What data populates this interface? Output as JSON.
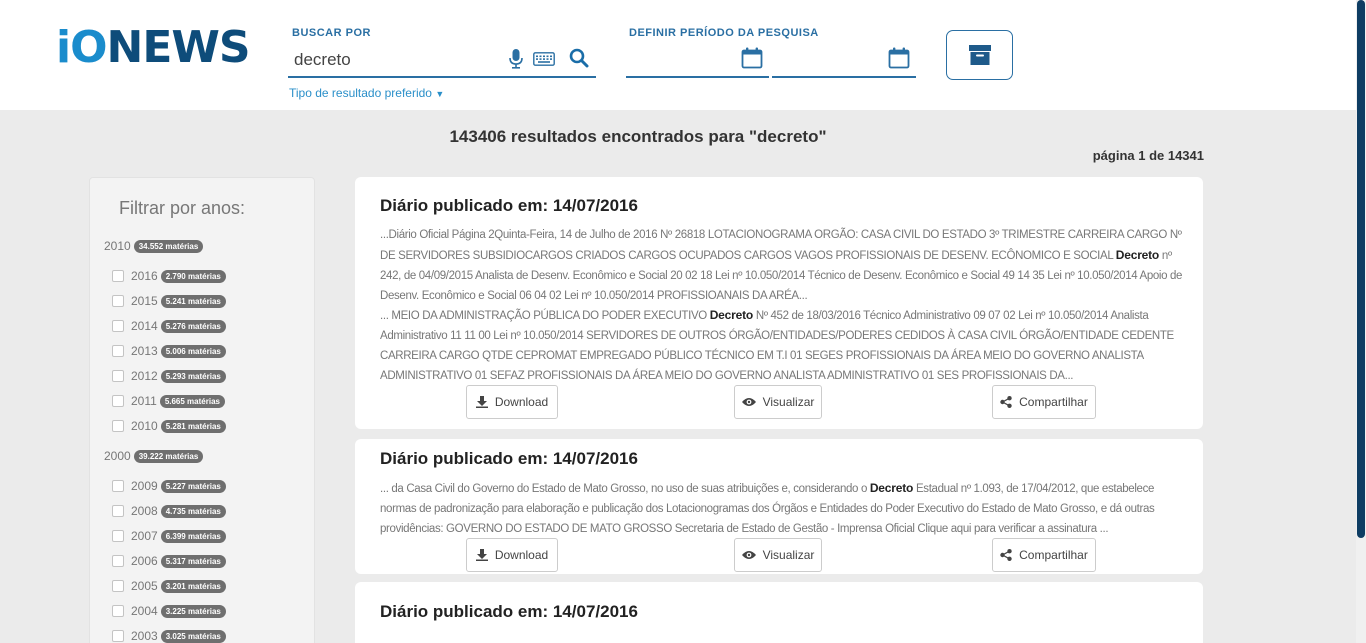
{
  "brand": {
    "logo_prefix": "iO",
    "logo_suffix": "NEWS"
  },
  "search": {
    "label": "BUSCAR POR",
    "value": "decreto",
    "placeholder": "",
    "result_type_link": "Tipo de resultado preferido"
  },
  "period": {
    "label": "DEFINIR PERÍODO DA PESQUISA",
    "start_date": "",
    "end_date": ""
  },
  "results": {
    "count_text": "143406 resultados encontrados para \"decreto\"",
    "page_text": "página 1 de 14341"
  },
  "sidebar": {
    "title": "Filtrar por anos:",
    "decades": [
      {
        "label": "2010",
        "badge": "34.552 matérias",
        "years": [
          {
            "label": "2016",
            "badge": "2.790 matérias"
          },
          {
            "label": "2015",
            "badge": "5.241 matérias"
          },
          {
            "label": "2014",
            "badge": "5.276 matérias"
          },
          {
            "label": "2013",
            "badge": "5.006 matérias"
          },
          {
            "label": "2012",
            "badge": "5.293 matérias"
          },
          {
            "label": "2011",
            "badge": "5.665 matérias"
          },
          {
            "label": "2010",
            "badge": "5.281 matérias"
          }
        ]
      },
      {
        "label": "2000",
        "badge": "39.222 matérias",
        "years": [
          {
            "label": "2009",
            "badge": "5.227 matérias"
          },
          {
            "label": "2008",
            "badge": "4.735 matérias"
          },
          {
            "label": "2007",
            "badge": "6.399 matérias"
          },
          {
            "label": "2006",
            "badge": "5.317 matérias"
          },
          {
            "label": "2005",
            "badge": "3.201 matérias"
          },
          {
            "label": "2004",
            "badge": "3.225 matérias"
          },
          {
            "label": "2003",
            "badge": "3.025 matérias"
          }
        ]
      }
    ]
  },
  "actions": {
    "download": "Download",
    "view": "Visualizar",
    "share": "Compartilhar"
  },
  "cards": [
    {
      "title": "Diário publicado em: 14/07/2016",
      "snippet_parts": [
        {
          "pre": "...Diário Oficial Página 2Quinta-Feira, 14 de Julho de 2016 Nº 26818 LOTACIONOGRAMA ORGÃO: CASA CIVIL DO ESTADO 3º TRIMESTRE CARREIRA CARGO Nº DE SERVIDORES SUBSIDIOCARGOS CRIADOS CARGOS OCUPADOS CARGOS VAGOS PROFISSIONAIS DE DESENV. ECÔNOMICO E SOCIAL ",
          "highlight": "Decreto",
          "post": " nº 242, de 04/09/2015 Analista de Desenv. Econômico e Social 20 02 18 Lei nº 10.050/2014 Técnico de Desenv. Econômico e Social 49 14 35 Lei nº 10.050/2014 Apoio de Desenv. Econômico e Social 06 04 02 Lei nº 10.050/2014 PROFISSIOANAIS DA ARÉA..."
        },
        {
          "pre": "... MEIO DA ADMINISTRAÇÃO PÚBLICA DO PODER EXECUTIVO ",
          "highlight": "Decreto",
          "post": " Nº 452 de 18/03/2016 Técnico Administrativo 09 07 02 Lei nº 10.050/2014 Analista Administrativo 11 11 00 Lei nº 10.050/2014 SERVIDORES DE OUTROS ÓRGÃO/ENTIDADES/PODERES CEDIDOS À CASA CIVIL ÓRGÃO/ENTIDADE CEDENTE CARREIRA CARGO QTDE CEPROMAT EMPREGADO PÚBLICO TÉCNICO EM T.I 01 SEGES PROFISSIONAIS DA ÁREA MEIO DO GOVERNO ANALISTA ADMINISTRATIVO 01 SEFAZ PROFISSIONAIS DA ÁREA MEIO DO GOVERNO ANALISTA ADMINISTRATIVO 01 SES PROFISSIONAIS DA..."
        }
      ]
    },
    {
      "title": "Diário publicado em: 14/07/2016",
      "snippet_parts": [
        {
          "pre": "... da Casa Civil do Governo do Estado de Mato Grosso, no uso de suas atribuições e, considerando o ",
          "highlight": "Decreto",
          "post": " Estadual nº 1.093, de 17/04/2012, que estabelece normas de padronização para elaboração e publicação dos Lotacionogramas dos Órgãos e Entidades do Poder Executivo do Estado de Mato Grosso, e dá outras providências: GOVERNO DO ESTADO DE MATO GROSSO Secretaria de Estado de Gestão - Imprensa Oficial Clique aqui para verificar a assinatura ..."
        }
      ]
    },
    {
      "title": "Diário publicado em: 14/07/2016",
      "snippet_parts": []
    }
  ],
  "colors": {
    "brand_dark": "#0e4c7a",
    "brand_accent": "#1a8ccc",
    "link": "#2a8fc9",
    "background": "#ebebeb"
  },
  "icons": [
    "mic-icon",
    "keyboard-icon",
    "search-icon",
    "calendar-icon",
    "archive-icon",
    "download-icon",
    "eye-icon",
    "share-icon"
  ]
}
